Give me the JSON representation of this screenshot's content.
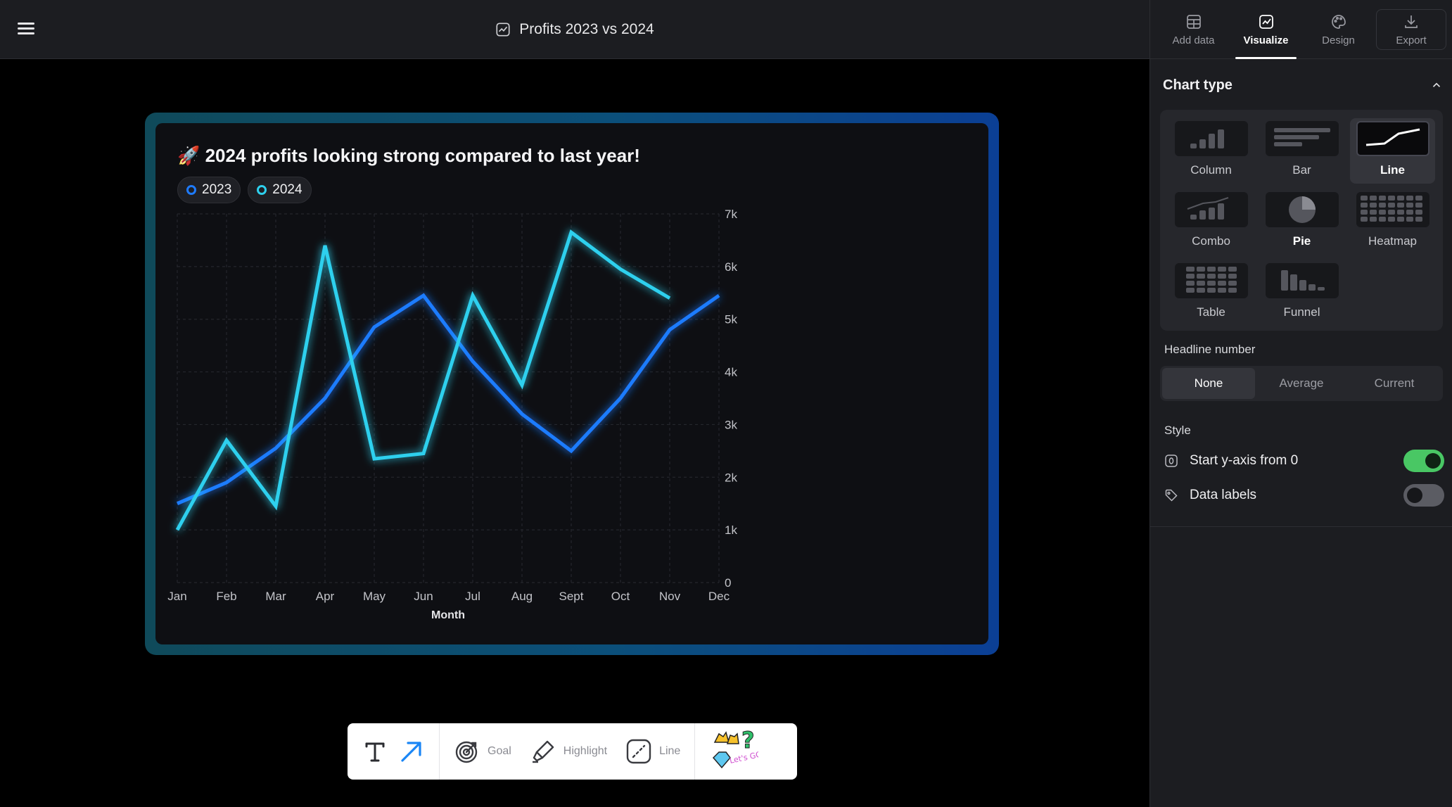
{
  "header": {
    "title": "Profits 2023 vs 2024"
  },
  "panel": {
    "tabs": [
      {
        "label": "Add data",
        "icon": "table-icon"
      },
      {
        "label": "Visualize",
        "icon": "chart-icon",
        "active": true
      },
      {
        "label": "Design",
        "icon": "palette-icon"
      },
      {
        "label": "Export",
        "icon": "download-icon"
      }
    ],
    "chart_type_title": "Chart type",
    "chart_types": [
      "Column",
      "Bar",
      "Line",
      "Combo",
      "Pie",
      "Heatmap",
      "Table",
      "Funnel"
    ],
    "chart_type_selected": "Line",
    "headline_label": "Headline number",
    "headline_options": [
      "None",
      "Average",
      "Current"
    ],
    "headline_selected": "None",
    "style_label": "Style",
    "style_options": [
      {
        "label": "Start y-axis from 0",
        "on": true
      },
      {
        "label": "Data labels",
        "on": false
      }
    ]
  },
  "card": {
    "title": "🚀 2024 profits looking strong compared to last year!",
    "legend": [
      {
        "label": "2023",
        "color": "#1e7bff"
      },
      {
        "label": "2024",
        "color": "#2ed0ee"
      }
    ]
  },
  "toolbar": {
    "goal_label": "Goal",
    "highlight_label": "Highlight",
    "line_label": "Line",
    "sticker_text": "Let's GO!"
  },
  "colors": {
    "accent_2023": "#1e7bff",
    "accent_2024": "#2ed0ee",
    "toggle_on": "#49c764",
    "glow_left": "#0f4a5a",
    "glow_right": "#0b3f95"
  },
  "chart_data": {
    "type": "line",
    "categories": [
      "Jan",
      "Feb",
      "Mar",
      "Apr",
      "May",
      "Jun",
      "Jul",
      "Aug",
      "Sept",
      "Oct",
      "Nov",
      "Dec"
    ],
    "series": [
      {
        "name": "2023",
        "values": [
          1500,
          1900,
          2550,
          3500,
          4850,
          5450,
          4200,
          3200,
          2500,
          3500,
          4800,
          5450
        ]
      },
      {
        "name": "2024",
        "values": [
          1000,
          2700,
          1450,
          6400,
          2350,
          2450,
          5450,
          3750,
          6650,
          5950,
          5400,
          null
        ]
      }
    ],
    "xlabel": "Month",
    "ylabel": "",
    "ylim": [
      0,
      7000
    ],
    "yticks": [
      "0",
      "1k",
      "2k",
      "3k",
      "4k",
      "5k",
      "6k",
      "7k"
    ],
    "grid": true,
    "legend_position": "top-left"
  }
}
